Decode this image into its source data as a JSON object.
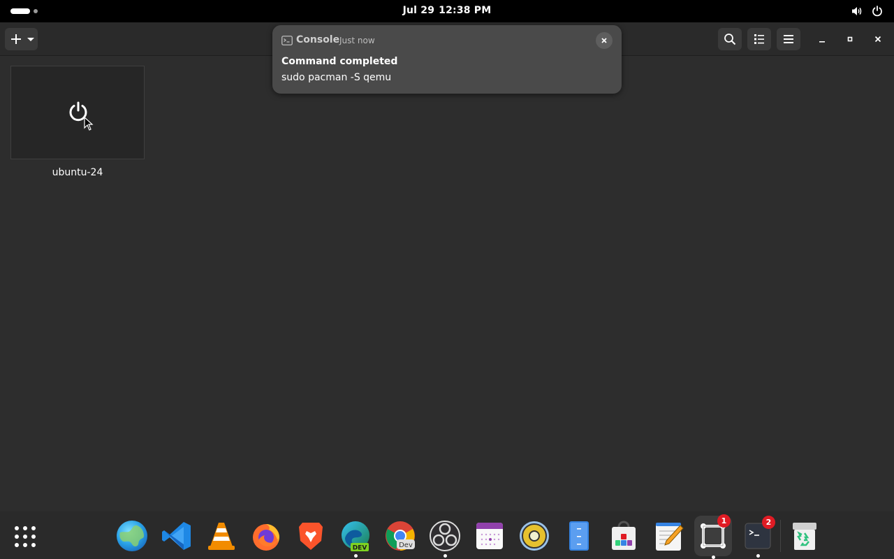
{
  "topbar": {
    "date": "Jul 29",
    "time": "12:38 PM",
    "icons": [
      "activities-indicator",
      "volume-icon",
      "power-icon"
    ]
  },
  "headerbar": {
    "new_button_icon": "plus-icon",
    "buttons": [
      "search-icon",
      "view-list-icon",
      "hamburger-menu-icon"
    ],
    "window_controls": [
      "minimize-icon",
      "maximize-icon",
      "close-icon"
    ]
  },
  "vm": {
    "name": "ubuntu-24",
    "state_icon": "power-icon"
  },
  "notification": {
    "app": "Console",
    "time": "Just now",
    "title": "Command completed",
    "body": "sudo pacman -S qemu"
  },
  "dock": {
    "items": [
      {
        "name": "show-apps",
        "icon": "app-grid-icon"
      },
      {
        "name": "web-browser",
        "icon": "globe-icon"
      },
      {
        "name": "vscode",
        "icon": "vscode-icon"
      },
      {
        "name": "vlc",
        "icon": "vlc-icon"
      },
      {
        "name": "firefox",
        "icon": "firefox-icon"
      },
      {
        "name": "brave",
        "icon": "brave-icon"
      },
      {
        "name": "edge-dev",
        "icon": "edge-dev-icon",
        "label": "DEV",
        "running": true
      },
      {
        "name": "chrome-dev",
        "icon": "chrome-dev-icon",
        "label": "Dev"
      },
      {
        "name": "obs",
        "icon": "obs-icon",
        "running": true
      },
      {
        "name": "calendar",
        "icon": "calendar-icon"
      },
      {
        "name": "rhythmbox",
        "icon": "speaker-icon"
      },
      {
        "name": "file-cabinet",
        "icon": "file-cabinet-icon"
      },
      {
        "name": "software",
        "icon": "software-store-icon"
      },
      {
        "name": "text-editor",
        "icon": "text-editor-icon"
      },
      {
        "name": "boxes",
        "icon": "boxes-icon",
        "badge": "1",
        "running": true,
        "active": true
      },
      {
        "name": "console",
        "icon": "terminal-icon",
        "badge": "2",
        "running": true
      },
      {
        "name": "trash",
        "icon": "trash-icon"
      }
    ]
  },
  "colors": {
    "background": "#2d2d2d",
    "topbar": "#000000",
    "badge": "#e01b24",
    "notification": "#4a4a4a"
  }
}
